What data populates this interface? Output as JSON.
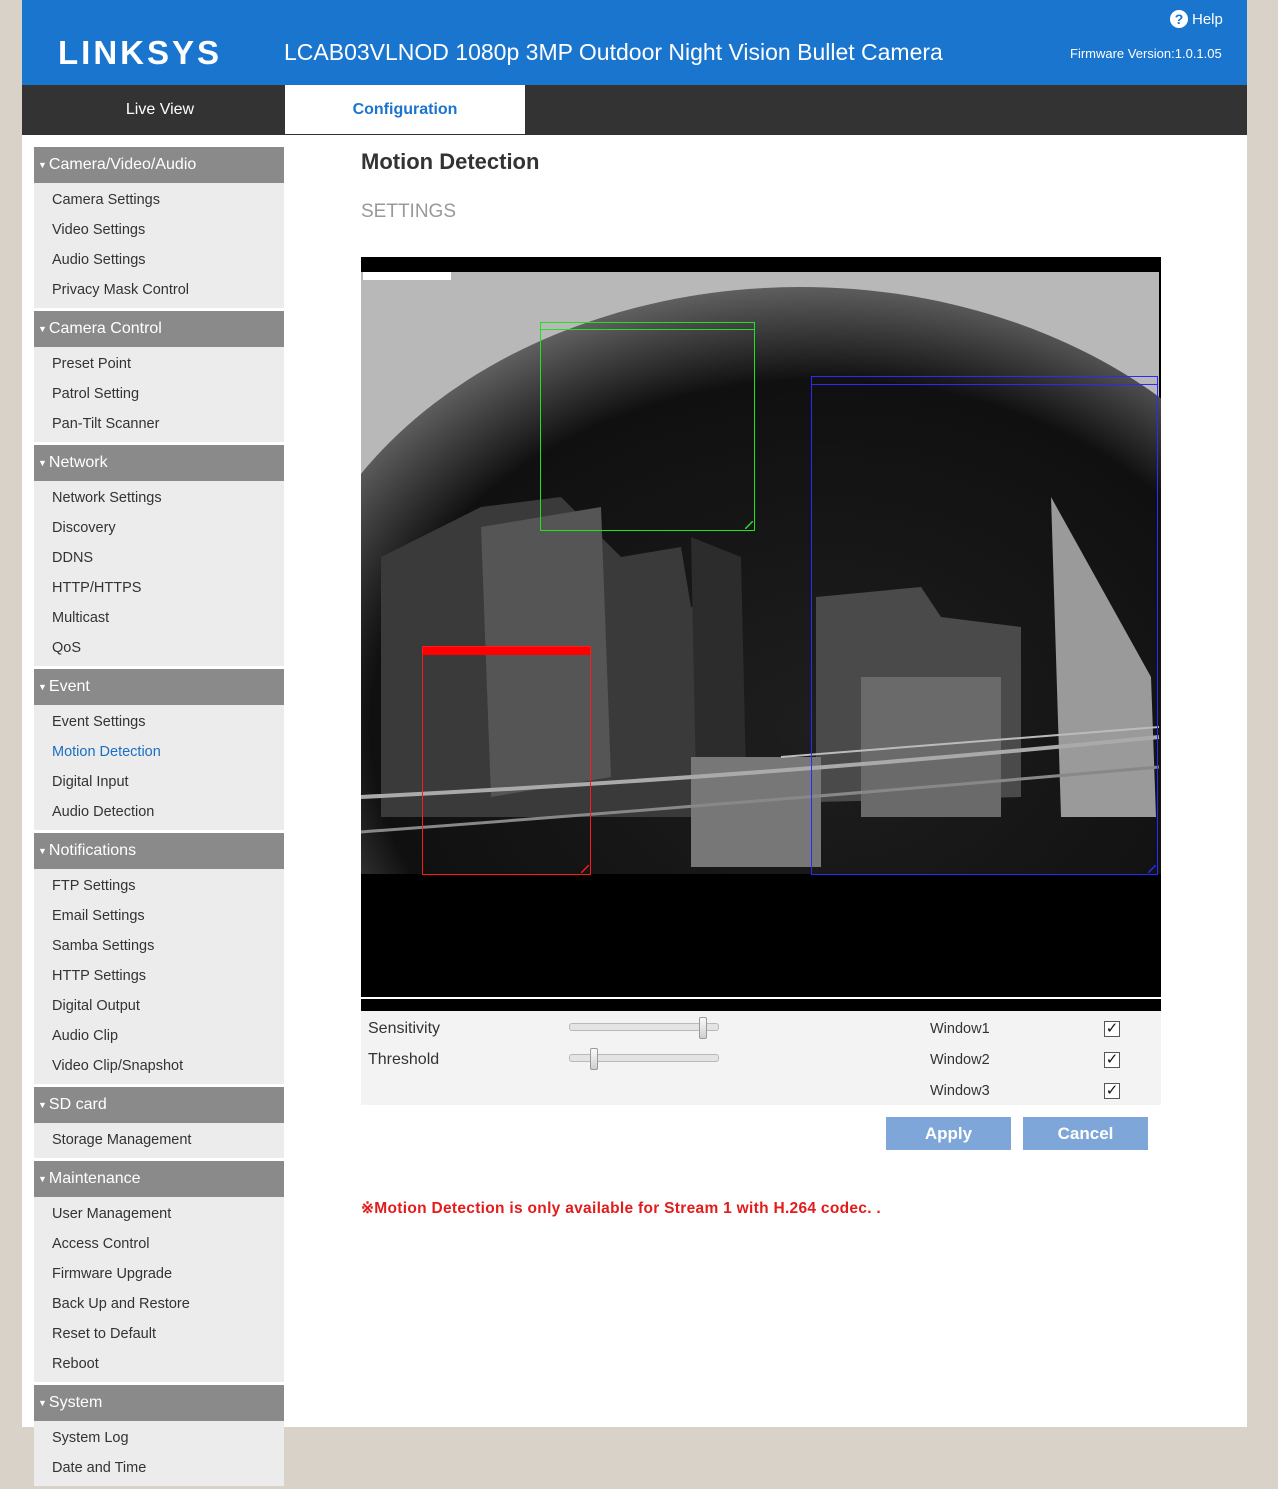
{
  "header": {
    "logo": "LINKSYS",
    "product_title": "LCAB03VLNOD 1080p 3MP Outdoor Night Vision Bullet Camera",
    "help_label": "Help",
    "firmware": "Firmware Version:1.0.1.05"
  },
  "tabs": {
    "live_view": "Live View",
    "configuration": "Configuration"
  },
  "sidebar": {
    "sections": [
      {
        "title": "Camera/Video/Audio",
        "items": [
          "Camera Settings",
          "Video Settings",
          "Audio Settings",
          "Privacy Mask Control"
        ]
      },
      {
        "title": "Camera Control",
        "items": [
          "Preset Point",
          "Patrol Setting",
          "Pan-Tilt Scanner"
        ]
      },
      {
        "title": "Network",
        "items": [
          "Network Settings",
          "Discovery",
          "DDNS",
          "HTTP/HTTPS",
          "Multicast",
          "QoS"
        ]
      },
      {
        "title": "Event",
        "items": [
          "Event Settings",
          "Motion Detection",
          "Digital Input",
          "Audio Detection"
        ]
      },
      {
        "title": "Notifications",
        "items": [
          "FTP Settings",
          "Email Settings",
          "Samba Settings",
          "HTTP Settings",
          "Digital Output",
          "Audio Clip",
          "Video Clip/Snapshot"
        ]
      },
      {
        "title": "SD card",
        "items": [
          "Storage Management"
        ]
      },
      {
        "title": "Maintenance",
        "items": [
          "User Management",
          "Access Control",
          "Firmware Upgrade",
          "Back Up and Restore",
          "Reset to Default",
          "Reboot"
        ]
      },
      {
        "title": "System",
        "items": [
          "System Log",
          "Date and Time"
        ]
      }
    ],
    "active_item": "Motion Detection"
  },
  "main": {
    "page_title": "Motion Detection",
    "section_label": "SETTINGS",
    "sensitivity_label": "Sensitivity",
    "threshold_label": "Threshold",
    "sensitivity_level": 0.92,
    "threshold_level": 0.14,
    "windows": [
      {
        "label": "Window1",
        "checked": true,
        "color": "#22e022"
      },
      {
        "label": "Window2",
        "checked": true,
        "color": "#2a2aff"
      },
      {
        "label": "Window3",
        "checked": true,
        "color": "#ff1a1a"
      }
    ],
    "apply_label": "Apply",
    "cancel_label": "Cancel",
    "notice": "※Motion Detection is only available for Stream 1 with H.264 codec. ."
  },
  "colors": {
    "brand_blue": "#1a75cf",
    "tab_bar": "#333333",
    "section_header": "#8a8a8a",
    "button": "#7ea6d8",
    "notice": "#e31b1b"
  }
}
